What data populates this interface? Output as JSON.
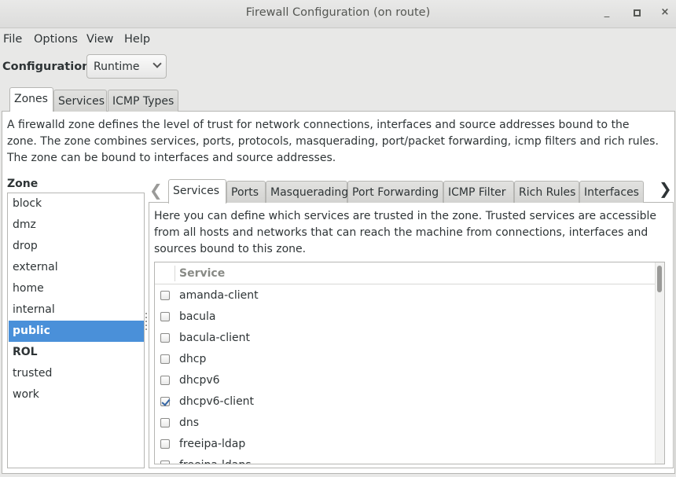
{
  "window": {
    "title": "Firewall Configuration (on route)",
    "minimize_glyph": "_",
    "close_glyph": "×"
  },
  "menu": [
    "File",
    "Options",
    "View",
    "Help"
  ],
  "configuration": {
    "label": "Configuration:",
    "value": "Runtime"
  },
  "main_tabs": [
    "Zones",
    "Services",
    "ICMP Types"
  ],
  "main_active_tab": "Zones",
  "description": "A firewalld zone defines the level of trust for network connections, interfaces and source addresses bound to the zone. The zone combines services, ports, protocols, masquerading, port/packet forwarding, icmp filters and rich rules. The zone can be bound to interfaces and source addresses.",
  "zones": {
    "label": "Zone",
    "items": [
      "block",
      "dmz",
      "drop",
      "external",
      "home",
      "internal",
      "public",
      "ROL",
      "trusted",
      "work"
    ],
    "selected": "public",
    "bold": [
      "ROL"
    ]
  },
  "zone_tabs": {
    "left_arrow": "❮",
    "right_arrow": "❯",
    "tabs": [
      "Services",
      "Ports",
      "Masquerading",
      "Port Forwarding",
      "ICMP Filter",
      "Rich Rules",
      "Interfaces"
    ],
    "active": "Services"
  },
  "services_description": "Here you can define which services are trusted in the zone. Trusted services are accessible from all hosts and networks that can reach the machine from connections, interfaces and sources bound to this zone.",
  "services_table": {
    "header": "Service",
    "rows": [
      {
        "name": "amanda-client",
        "checked": false
      },
      {
        "name": "bacula",
        "checked": false
      },
      {
        "name": "bacula-client",
        "checked": false
      },
      {
        "name": "dhcp",
        "checked": false
      },
      {
        "name": "dhcpv6",
        "checked": false
      },
      {
        "name": "dhcpv6-client",
        "checked": true
      },
      {
        "name": "dns",
        "checked": false
      },
      {
        "name": "freeipa-ldap",
        "checked": false
      },
      {
        "name": "freeipa-ldaps",
        "checked": false
      }
    ]
  }
}
